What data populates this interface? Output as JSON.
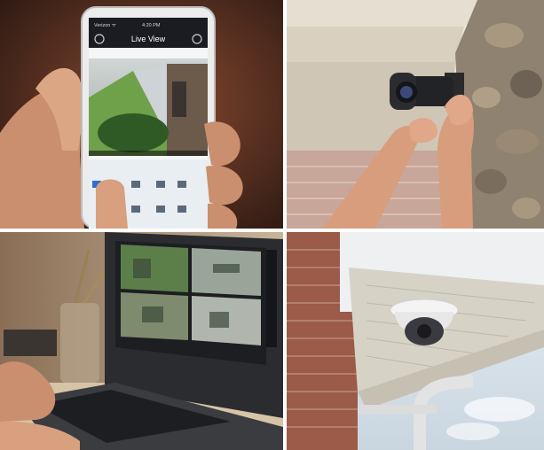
{
  "panels": {
    "phone": {
      "status_left": "Verizon ᯤ",
      "status_time": "4:20 PM",
      "screen_title": "Live View"
    },
    "bullet_camera": {},
    "laptop": {},
    "dome_camera": {}
  },
  "colors": {
    "phone_bg": "#3a2218",
    "phone_bg_light": "#8a4a30",
    "screen_header": "#1b1b22",
    "screen_toolbar": "#e9eef3",
    "accent_blue": "#2f6fd0",
    "skin": "#d9a07e",
    "brick": "#b16a55",
    "stone": "#8f8270",
    "sky": "#dfe8ef",
    "laptop_body": "#2a2c30"
  }
}
